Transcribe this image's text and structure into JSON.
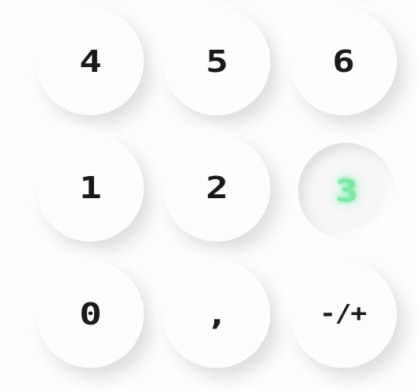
{
  "keypad": {
    "keys": [
      {
        "label": "4"
      },
      {
        "label": "5"
      },
      {
        "label": "6"
      },
      {
        "label": "1"
      },
      {
        "label": "2"
      },
      {
        "label": "3"
      },
      {
        "label": "0"
      },
      {
        "label": ","
      },
      {
        "label": "-/+"
      }
    ],
    "active_key": "3",
    "active_glow_color": "#7de8a6",
    "label_color": "#1a1a1a",
    "key_color": "#fdfdfd"
  }
}
